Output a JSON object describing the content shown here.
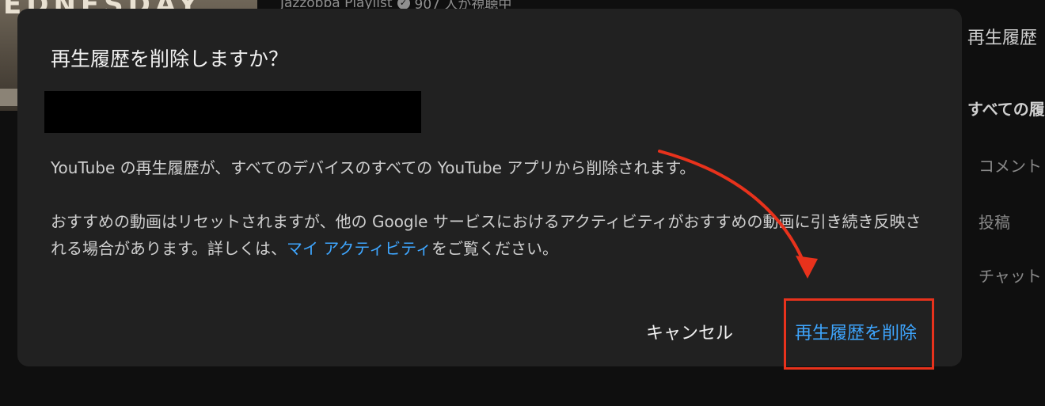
{
  "background": {
    "thumbnail_text": "EDNESDAY",
    "playlist_meta": {
      "channel": "Jazzobba Playlist",
      "views": "907 人が視聴中"
    },
    "right_panel": {
      "title": "再生履歴",
      "subtitle": "すべての履",
      "items": [
        "コメント",
        "投稿",
        "チャット"
      ]
    }
  },
  "dialog": {
    "title": "再生履歴を削除しますか？",
    "body_line1": "YouTube の再生履歴が、すべてのデバイスのすべての YouTube アプリから削除されます。",
    "body_line2_prefix": "おすすめの動画はリセットされますが、他の Google サービスにおけるアクティビティがおすすめの動画に引き続き反映される場合があります。詳しくは、",
    "body_link": "マイ アクティビティ",
    "body_line2_suffix": "をご覧ください。",
    "cancel_label": "キャンセル",
    "confirm_label": "再生履歴を削除"
  },
  "annotation_color": "#e8321c",
  "accent_color": "#3ea6ff"
}
